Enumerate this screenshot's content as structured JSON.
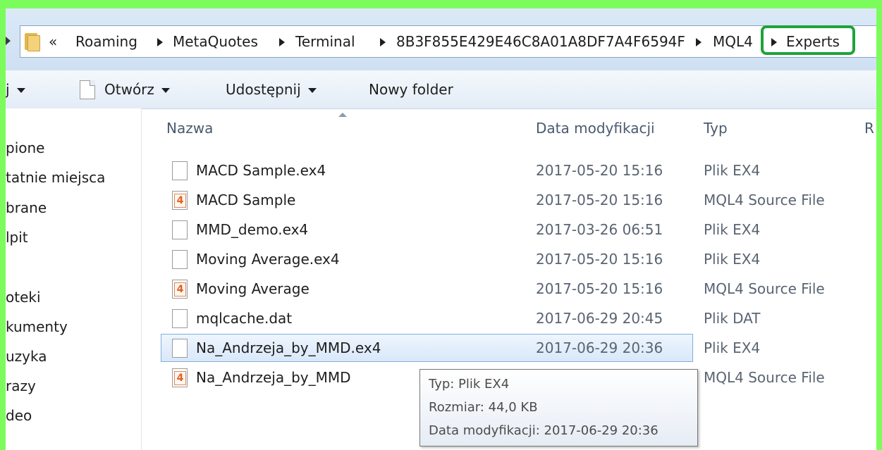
{
  "address_bar": {
    "overflow": "«",
    "crumbs": [
      "Roaming",
      "MetaQuotes",
      "Terminal",
      "8B3F855E429E46C8A01A8DF7A4F6594F",
      "MQL4",
      "Experts"
    ]
  },
  "toolbar": {
    "organize_partial": "j",
    "open_label": "Otwórz",
    "share_label": "Udostępnij",
    "new_folder_label": "Nowy folder"
  },
  "nav": {
    "items": [
      "pione",
      "tatnie miejsca",
      "brane",
      "lpit",
      "oteki",
      "kumenty",
      "uzyka",
      "razy",
      "deo"
    ]
  },
  "columns": {
    "name": "Nazwa",
    "date": "Data modyfikacji",
    "type": "Typ",
    "size_partial": "R"
  },
  "files": [
    {
      "name": "MACD Sample.ex4",
      "date": "2017-05-20 15:16",
      "type": "Plik EX4",
      "icon": "file-icon"
    },
    {
      "name": "MACD Sample",
      "date": "2017-05-20 15:16",
      "type": "MQL4 Source File",
      "icon": "mql4-file-icon"
    },
    {
      "name": "MMD_demo.ex4",
      "date": "2017-03-26 06:51",
      "type": "Plik EX4",
      "icon": "file-icon"
    },
    {
      "name": "Moving Average.ex4",
      "date": "2017-05-20 15:16",
      "type": "Plik EX4",
      "icon": "file-icon"
    },
    {
      "name": "Moving Average",
      "date": "2017-05-20 15:16",
      "type": "MQL4 Source File",
      "icon": "mql4-file-icon"
    },
    {
      "name": "mqlcache.dat",
      "date": "2017-06-29 20:45",
      "type": "Plik DAT",
      "icon": "file-icon"
    },
    {
      "name": "Na_Andrzeja_by_MMD.ex4",
      "date": "2017-06-29 20:36",
      "type": "Plik EX4",
      "icon": "file-icon"
    },
    {
      "name": "Na_Andrzeja_by_MMD",
      "date": "",
      "type": "MQL4 Source File",
      "icon": "mql4-file-icon"
    }
  ],
  "mql4_icon_glyph": "4",
  "tooltip": {
    "type": "Typ: Plik EX4",
    "size": "Rozmiar: 44,0 KB",
    "modified": "Data modyfikacji: 2017-06-29 20:36"
  },
  "colors": {
    "background_green": "#7cfc5c",
    "highlight_box": "#1fa33a",
    "selection": "#d9e8fa"
  }
}
